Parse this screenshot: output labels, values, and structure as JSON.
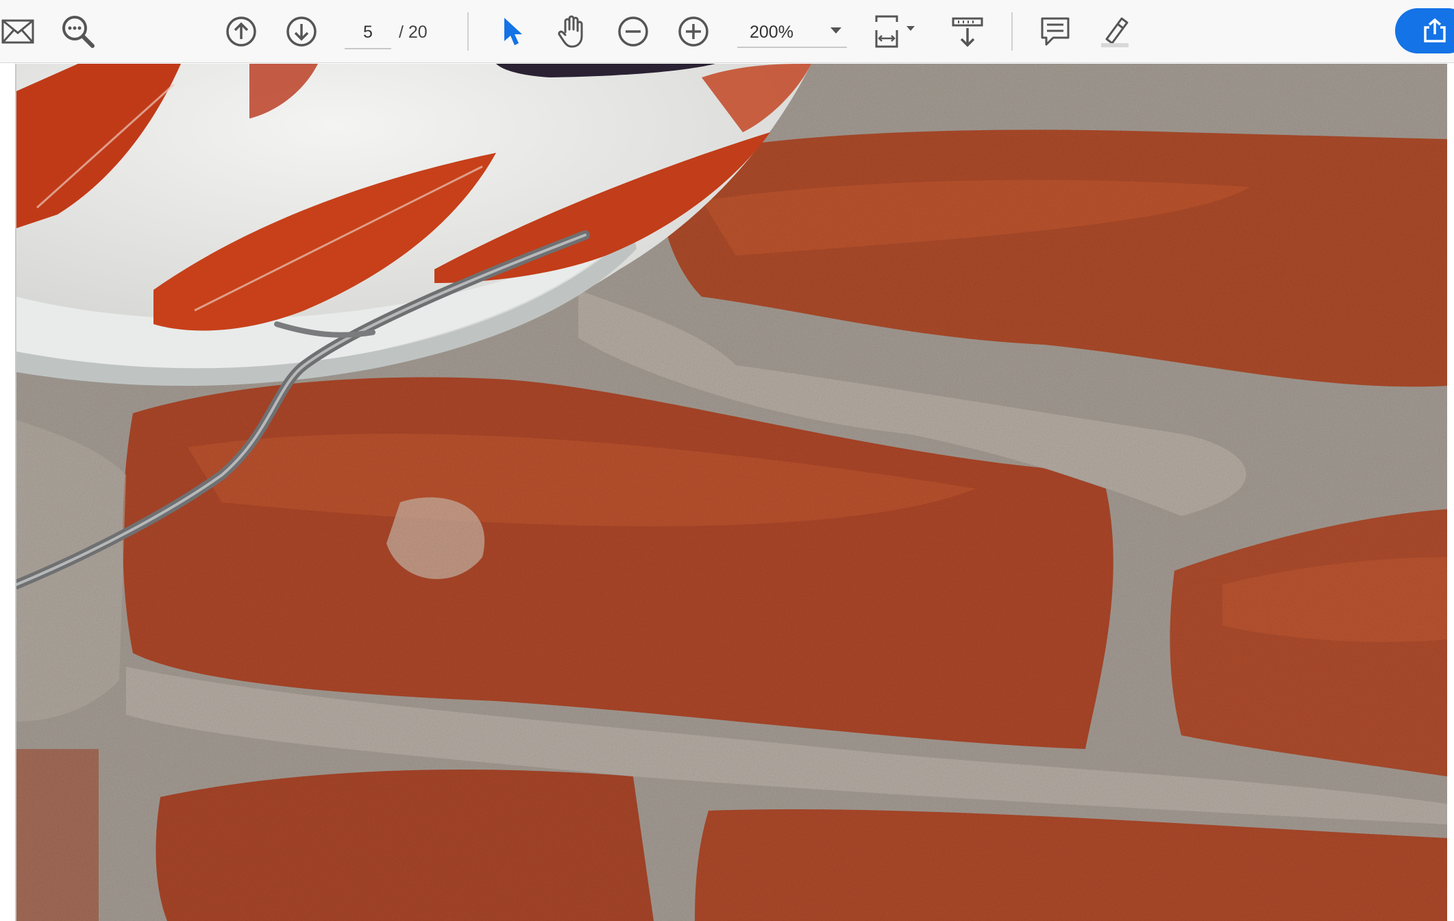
{
  "toolbar": {
    "page": {
      "current": "5",
      "total_label": "/  20"
    },
    "zoom": {
      "value": "200%"
    },
    "icons": {
      "email": "envelope-icon",
      "search": "search-icon",
      "prev_page": "arrow-up-circle-icon",
      "next_page": "arrow-down-circle-icon",
      "select": "pointer-arrow-icon",
      "hand": "hand-icon",
      "zoom_out": "minus-circle-icon",
      "zoom_in": "plus-circle-icon",
      "fit": "fit-page-icon",
      "scroll": "scroll-mode-icon",
      "comment": "comment-icon",
      "highlight": "pen-icon",
      "share": "share-icon"
    },
    "colors": {
      "accent": "#1473e6",
      "icon": "#555555",
      "background": "#f8f8f8"
    }
  }
}
